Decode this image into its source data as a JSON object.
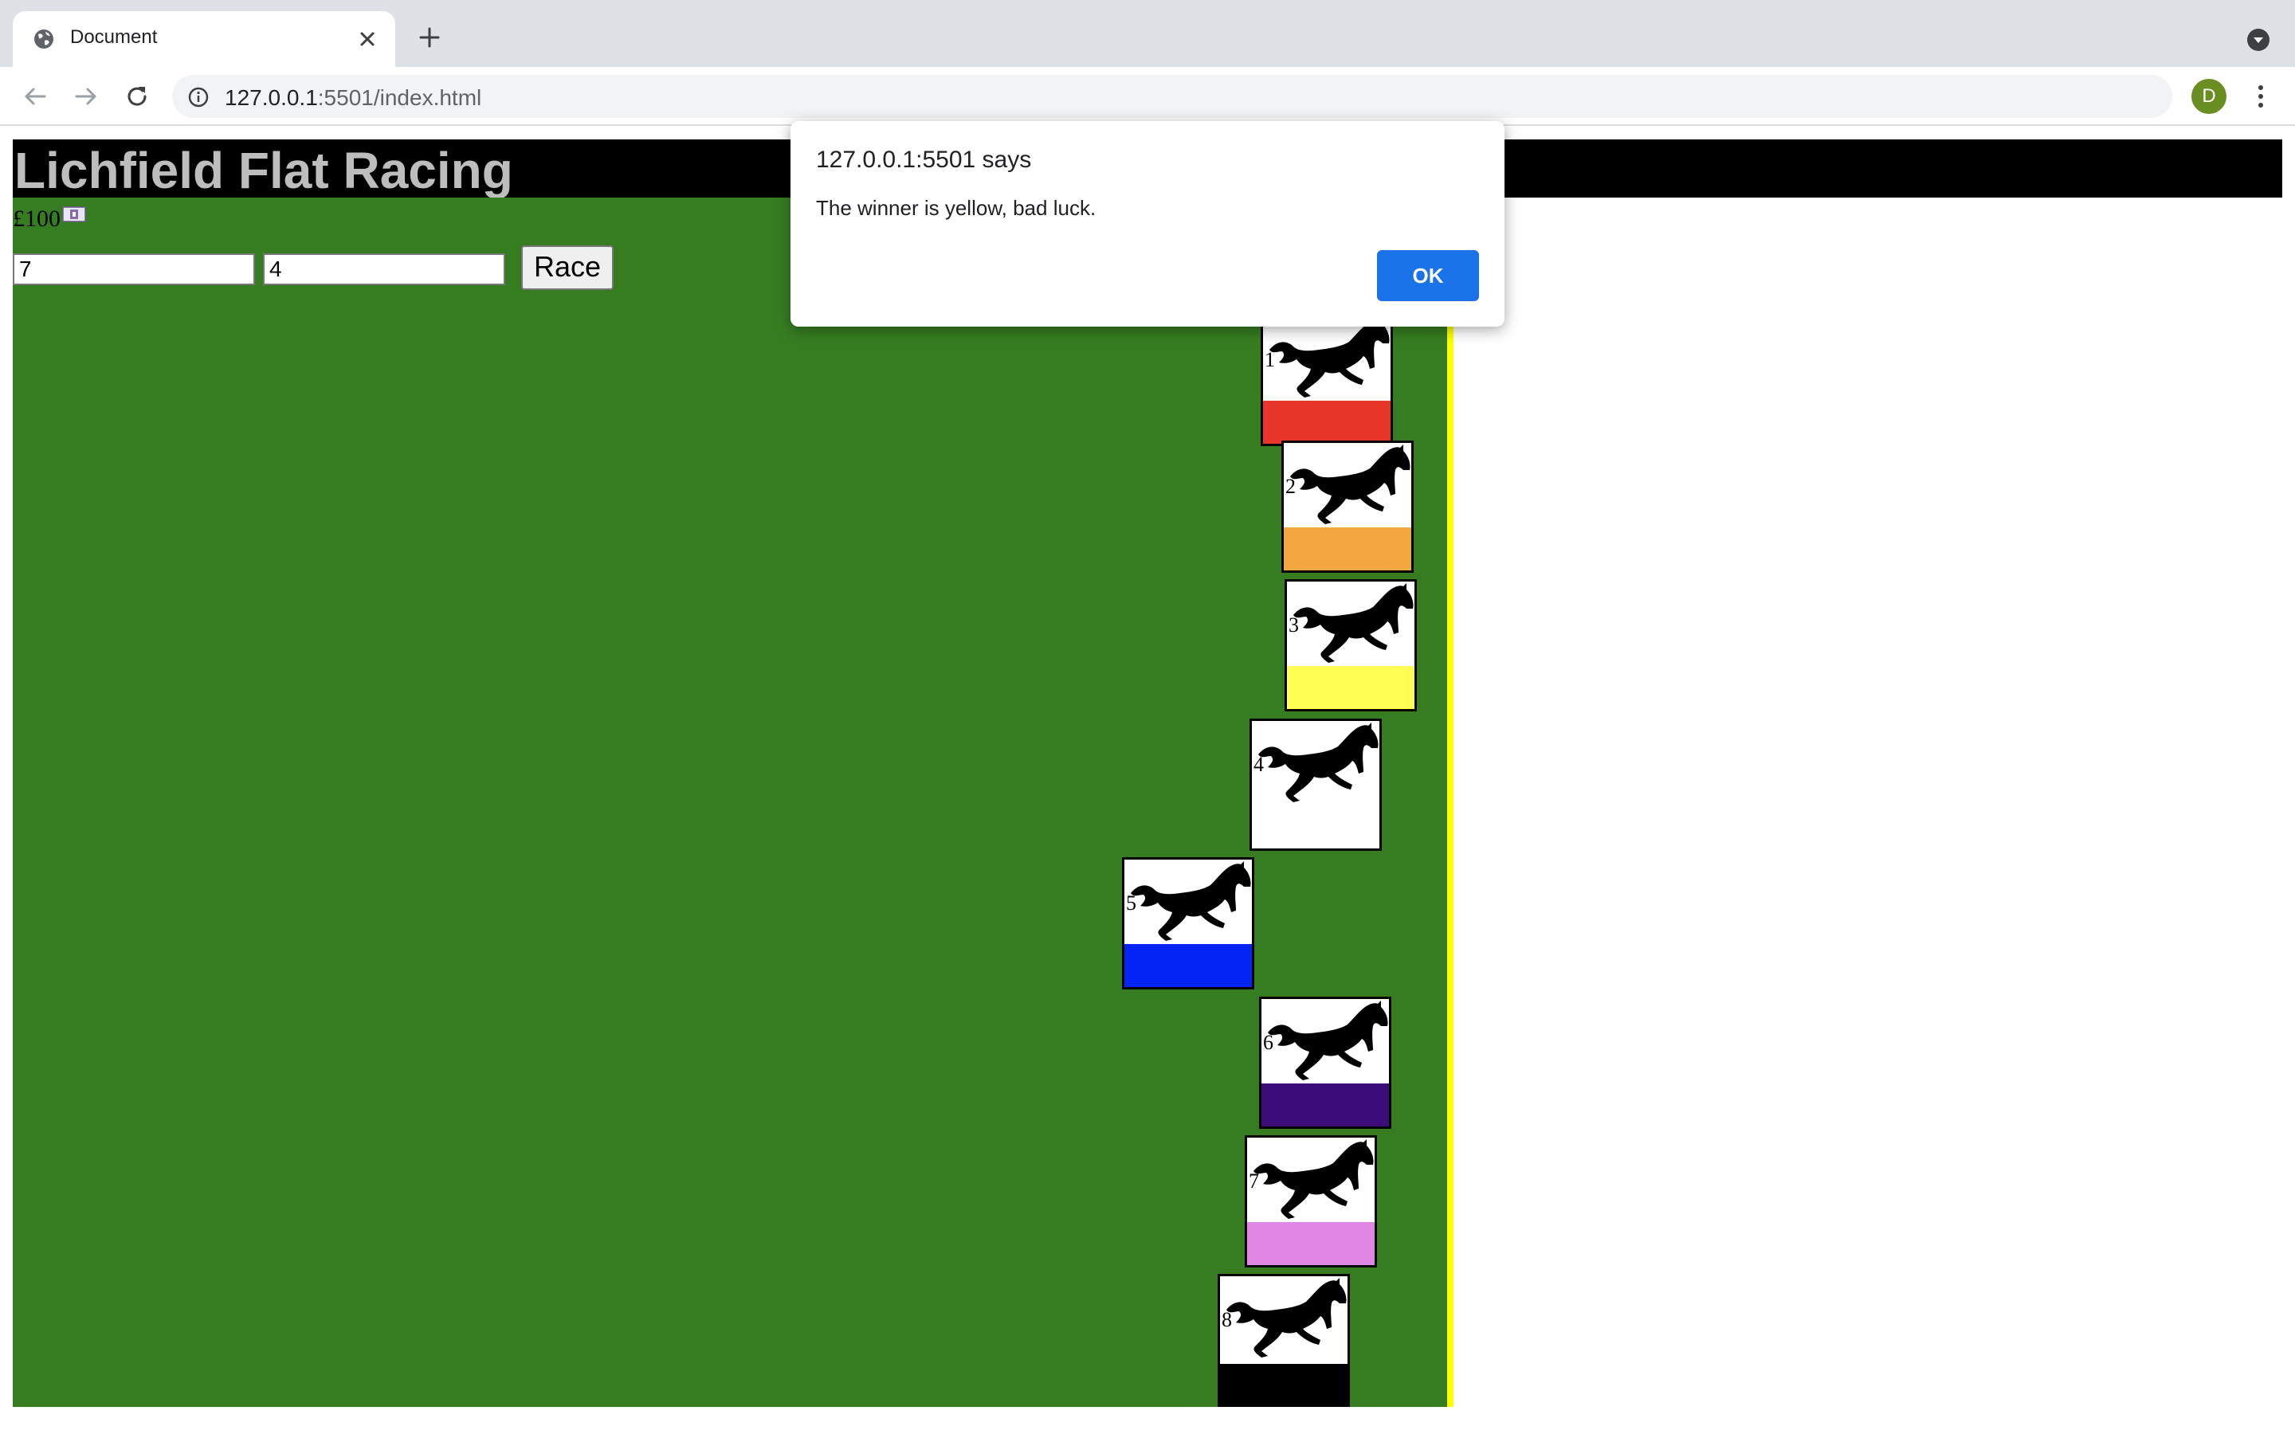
{
  "browser": {
    "tab_title": "Document",
    "url_host": "127.0.0.1",
    "url_rest": ":5501/index.html",
    "avatar_initial": "D"
  },
  "page": {
    "title": "Lichfield Flat Racing",
    "balance": "£100",
    "bet_horse_value": "7",
    "bet_amount_value": "4",
    "race_button": "Race",
    "colors": {
      "track": "#367d21",
      "finish_line": "#ffff00",
      "header": "#000000",
      "title_text": "#bdbdbd"
    }
  },
  "horses": [
    {
      "number": "1",
      "color": "#e8352a"
    },
    {
      "number": "2",
      "color": "#f2a73f"
    },
    {
      "number": "3",
      "color": "#ffff55"
    },
    {
      "number": "4",
      "color": "#ffffff"
    },
    {
      "number": "5",
      "color": "#0324f5"
    },
    {
      "number": "6",
      "color": "#3c0d79"
    },
    {
      "number": "7",
      "color": "#e086e3"
    },
    {
      "number": "8",
      "color": "#000000"
    }
  ],
  "dialog": {
    "title": "127.0.0.1:5501 says",
    "message": "The winner is yellow, bad luck.",
    "ok_label": "OK"
  }
}
